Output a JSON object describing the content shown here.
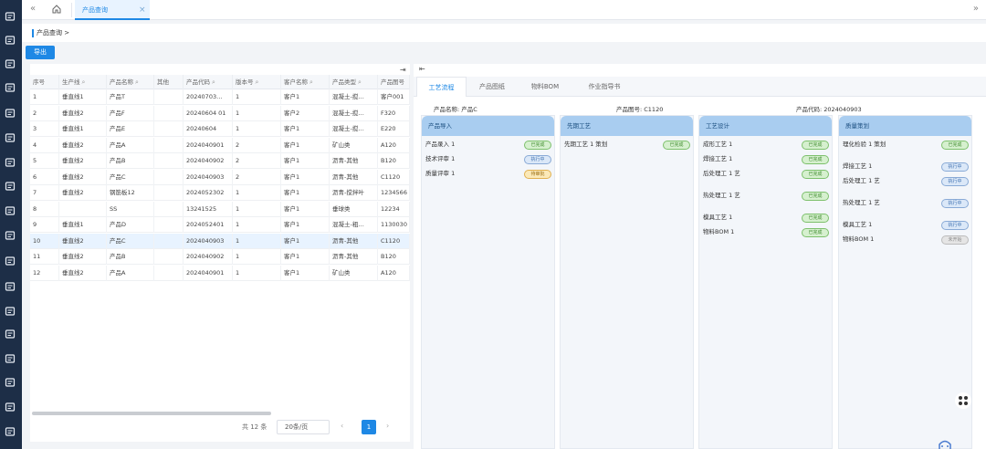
{
  "tabbar": {
    "tab_label": "产品查询",
    "close": "×",
    "collapse": "«",
    "expand": "»"
  },
  "breadcrumb": {
    "label": "产品查询",
    "arrow": ">"
  },
  "toolbar": {
    "export_label": "导出"
  },
  "table": {
    "columns": [
      "序号",
      "生产线",
      "产品名称",
      "其他",
      "产品代码",
      "版本号",
      "客户名称",
      "产品类型",
      "产品图号"
    ],
    "rows": [
      [
        "1",
        "垂直线1",
        "产品T",
        "",
        "20240703…",
        "1",
        "客户1",
        "混凝土-搅…",
        "客户001"
      ],
      [
        "2",
        "垂直线2",
        "产品F",
        "",
        "20240604 01",
        "1",
        "客户2",
        "混凝土-搅…",
        "F320"
      ],
      [
        "3",
        "垂直线1",
        "产品E",
        "",
        "20240604",
        "1",
        "客户1",
        "混凝土-搅…",
        "E220"
      ],
      [
        "4",
        "垂直线2",
        "产品A",
        "",
        "2024040901",
        "2",
        "客户1",
        "矿山类",
        "A120"
      ],
      [
        "5",
        "垂直线2",
        "产品B",
        "",
        "2024040902",
        "2",
        "客户1",
        "沥青-其他",
        "B120"
      ],
      [
        "6",
        "垂直线2",
        "产品C",
        "",
        "2024040903",
        "2",
        "客户1",
        "沥青-其他",
        "C1120"
      ],
      [
        "7",
        "垂直线2",
        "钢筋板12",
        "",
        "2024052302",
        "1",
        "客户1",
        "沥青-搅拌叶",
        "1234566"
      ],
      [
        "8",
        "",
        "SS",
        "",
        "13241525",
        "1",
        "客户1",
        "垂球类",
        "12234"
      ],
      [
        "9",
        "垂直线1",
        "产品D",
        "",
        "2024052401",
        "1",
        "客户1",
        "混凝土-粗…",
        "1130030"
      ],
      [
        "10",
        "垂直线2",
        "产品C",
        "",
        "2024040903",
        "1",
        "客户1",
        "沥青-其他",
        "C1120"
      ],
      [
        "11",
        "垂直线2",
        "产品B",
        "",
        "2024040902",
        "1",
        "客户1",
        "沥青-其他",
        "B120"
      ],
      [
        "12",
        "垂直线2",
        "产品A",
        "",
        "2024040901",
        "1",
        "客户1",
        "矿山类",
        "A120"
      ]
    ],
    "selected_row": 9
  },
  "pager": {
    "total": "共 12 条",
    "page_size": "20条/页",
    "current": "1",
    "prev": "‹",
    "next": "›"
  },
  "right": {
    "tabs": [
      "工艺流程",
      "产品图纸",
      "物料BOM",
      "作业指导书"
    ],
    "active_tab": 0,
    "info": {
      "name": "产品名称:  产品C",
      "drawing": "产品图号:  C1120",
      "code": "产品代码:  2024040903"
    },
    "columns": [
      {
        "title": "产品导入",
        "items": [
          {
            "name": "产品录入  1",
            "status": "已完成",
            "kind": "done"
          },
          {
            "name": "技术评审  1",
            "status": "执行中",
            "kind": "run"
          },
          {
            "name": "质量评审  1",
            "status": "待审批",
            "kind": "wait"
          }
        ]
      },
      {
        "title": "先期工艺",
        "items": [
          {
            "name": "先期工艺  1 策划",
            "status": "已完成",
            "kind": "done"
          }
        ]
      },
      {
        "title": "工艺设计",
        "items": [
          {
            "name": "成形工艺  1",
            "status": "已完成",
            "kind": "done"
          },
          {
            "name": "焊接工艺  1",
            "status": "已完成",
            "kind": "done"
          },
          {
            "name": "后处理工  1 艺",
            "status": "已完成",
            "kind": "done"
          },
          {
            "name": "热处理工  1 艺",
            "status": "已完成",
            "kind": "done"
          },
          {
            "name": "模具工艺  1",
            "status": "已完成",
            "kind": "done"
          },
          {
            "name": "物料BOM  1",
            "status": "已完成",
            "kind": "done"
          }
        ]
      },
      {
        "title": "质量策划",
        "items": [
          {
            "name": "理化检验  1 策划",
            "status": "已完成",
            "kind": "done"
          },
          {
            "name": "焊接工艺  1",
            "status": "执行中",
            "kind": "run"
          },
          {
            "name": "后处理工  1 艺",
            "status": "执行中",
            "kind": "run"
          },
          {
            "name": "热处理工  1 艺",
            "status": "执行中",
            "kind": "run"
          },
          {
            "name": "模具工艺  1",
            "status": "执行中",
            "kind": "run"
          },
          {
            "name": "物料BOM  1",
            "status": "未开始",
            "kind": "todo"
          }
        ]
      }
    ]
  },
  "colors": {
    "accent": "#1e88e5",
    "sidebar": "#1d2e47",
    "column_header": "#a9cdf0"
  }
}
